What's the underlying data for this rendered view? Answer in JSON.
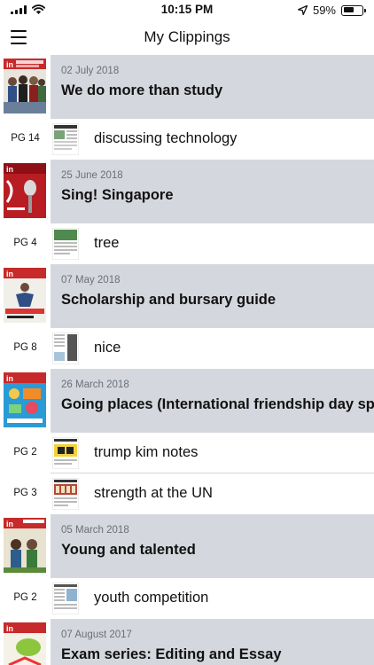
{
  "status_bar": {
    "time": "10:15 PM",
    "battery": "59%",
    "battery_level": 0.59
  },
  "nav": {
    "title": "My Clippings"
  },
  "issues": [
    {
      "date": "02 July 2018",
      "title": "We do more than study",
      "clippings": [
        {
          "page": "PG 14",
          "label": "discussing technology"
        }
      ]
    },
    {
      "date": "25 June 2018",
      "title": "Sing! Singapore",
      "clippings": [
        {
          "page": "PG 4",
          "label": "tree"
        }
      ]
    },
    {
      "date": "07 May 2018",
      "title": "Scholarship and bursary guide",
      "clippings": [
        {
          "page": "PG 8",
          "label": "nice"
        }
      ]
    },
    {
      "date": "26 March 2018",
      "title": "Going places (International friendship day spec",
      "clippings": [
        {
          "page": "PG 2",
          "label": "trump kim notes"
        },
        {
          "page": "PG 3",
          "label": "strength at the UN"
        }
      ]
    },
    {
      "date": "05 March 2018",
      "title": "Young and talented",
      "clippings": [
        {
          "page": "PG 2",
          "label": "youth competition"
        }
      ]
    },
    {
      "date": "07 August 2017",
      "title": "Exam series: Editing and Essay",
      "clippings": []
    }
  ]
}
